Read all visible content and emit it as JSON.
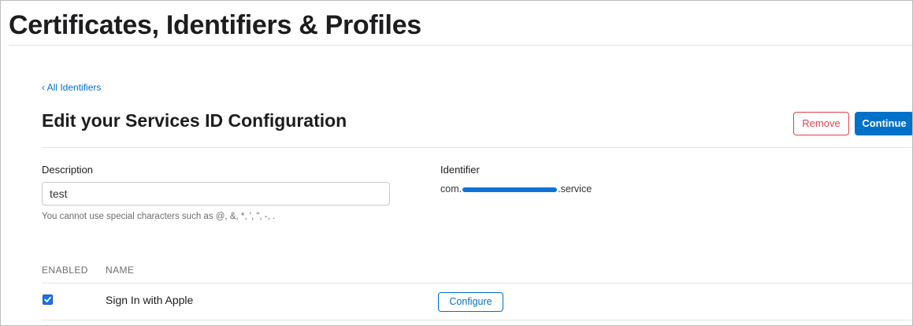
{
  "header": {
    "title": "Certificates, Identifiers & Profiles"
  },
  "nav": {
    "back_link": "‹ All Identifiers"
  },
  "main": {
    "section_title": "Edit your Services ID Configuration",
    "remove_label": "Remove",
    "continue_label": "Continue",
    "description": {
      "label": "Description",
      "value": "test",
      "hint": "You cannot use special characters such as @, &, *, ', \", -, ."
    },
    "identifier": {
      "label": "Identifier",
      "prefix": "com.",
      "suffix": ".service"
    },
    "table": {
      "headers": [
        "ENABLED",
        "NAME"
      ],
      "rows": [
        {
          "enabled": true,
          "name": "Sign In with Apple",
          "action_label": "Configure"
        }
      ]
    }
  },
  "colors": {
    "accent": "#0071c9",
    "danger": "#e0434b",
    "checkbox": "#1a73e8",
    "redaction": "#1172d6"
  }
}
